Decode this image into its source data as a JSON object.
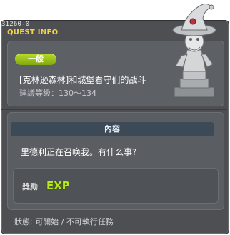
{
  "window": {
    "quest_id": "31260-0",
    "title": "QUEST INFO"
  },
  "quest": {
    "category_badge": "一般",
    "name": "[克林逊森林]和城堡看守们的战斗",
    "level_requirement": "建議等级：130～134",
    "npc_icon": "statue-wizard-npc-icon"
  },
  "content": {
    "header": "內容",
    "text": "里德利正在召唤我。有什么事?"
  },
  "reward": {
    "label": "獎勵",
    "icon": "exp-icon",
    "icon_text": "EXP"
  },
  "status": {
    "text": "狀態: 可開始 / 不可執行任務"
  },
  "colors": {
    "window_bg": "#4d4f52",
    "title_yellow": "#f2d24a",
    "badge_green": "#9cc81c",
    "exp_green": "#b7e81c"
  }
}
